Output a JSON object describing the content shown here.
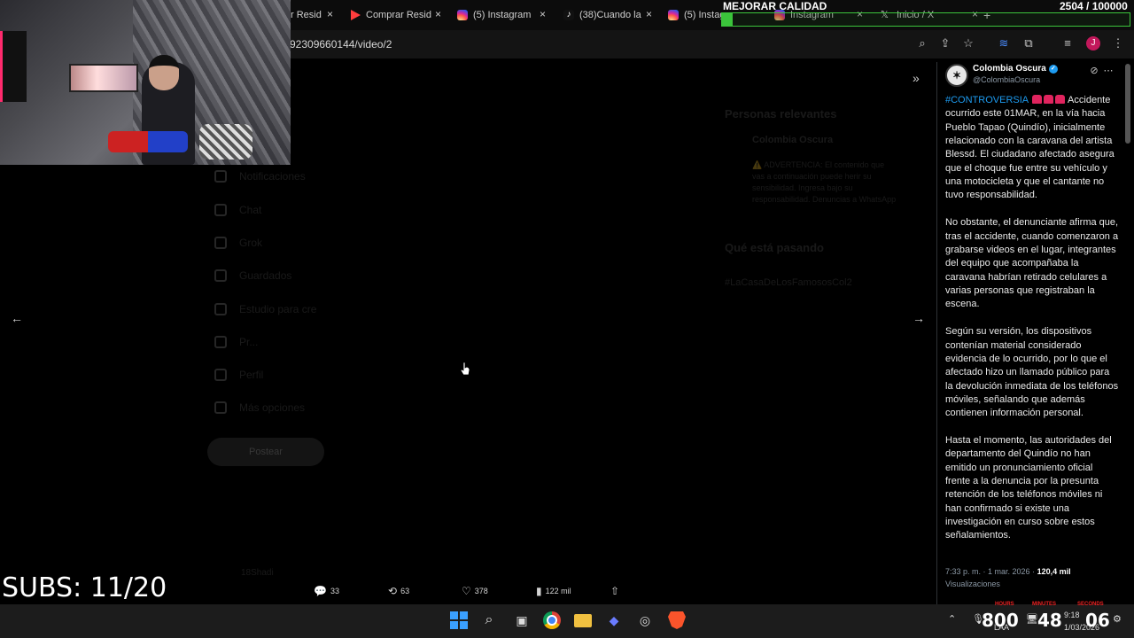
{
  "browser": {
    "tabs": [
      {
        "label": "r Resid",
        "icon": "none"
      },
      {
        "label": "Comprar Resid",
        "icon": "play"
      },
      {
        "label": "(5) Instagram",
        "icon": "instagram"
      },
      {
        "label": "(38)Cuando la",
        "icon": "tiktok"
      },
      {
        "label": "(5) Instagram",
        "icon": "instagram"
      },
      {
        "label": "Instagram",
        "icon": "instagram"
      },
      {
        "label": "Inicio / X",
        "icon": "x"
      }
    ],
    "tab_close": "×",
    "url": "92309660144/video/2",
    "new_tab": "+"
  },
  "overlay": {
    "quality_label": "MEJORAR CALIDAD",
    "goal_text": "2504 / 100000",
    "goal_progress": 0.025,
    "subs_label": "SUBS: 11/20"
  },
  "background_page": {
    "nav_items": [
      "Notificaciones",
      "Chat",
      "Grok",
      "Guardados",
      "Estudio para cre",
      "Pr...",
      "Perfil",
      "Más opciones"
    ],
    "post_button": "Postear",
    "right_heading_1": "Personas relevantes",
    "right_heading_2": "Qué está pasando",
    "relevant_name": "Colombia Oscura",
    "relevant_desc": "⚠️ ADVERTENCIA: El contenido que vas a continuación puede herir su sensibilidad. Ingresa bajo su responsabilidad. Denuncias a WhatsApp",
    "trend": "#LaCasaDeLosFamososCol2",
    "bottom_user": "18Shadi"
  },
  "tweet": {
    "display_name": "Colombia Oscura",
    "handle": "@ColombiaOscura",
    "hashtag": "#CONTROVERSIA",
    "p1_rest": "Accidente ocurrido este 01MAR, en la vía hacia Pueblo Tapao (Quindío), inicialmente relacionado con la caravana del artista Blessd. El ciudadano afectado asegura que el choque fue entre su vehículo y una motocicleta y que el cantante no tuvo responsabilidad.",
    "p2": "No obstante, el denunciante afirma que, tras el accidente, cuando comenzaron a grabarse videos en el lugar, integrantes del equipo que acompañaba la caravana habrían retirado celulares a varias personas que registraban la escena.",
    "p3": "Según su versión, los dispositivos contenían material considerado evidencia de lo ocurrido, por lo que el afectado hizo un llamado público para la devolución inmediata de los teléfonos móviles, señalando que además contienen información personal.",
    "p4": "Hasta el momento, las autoridades del departamento del Quindío no han emitido un pronunciamiento oficial frente a la denuncia por la presunta retención de los teléfonos móviles ni han confirmado si existe una investigación en curso sobre estos señalamientos.",
    "time": "7:33 p. m. · 1 mar. 2026 · ",
    "views_count": "120,4 mil",
    "views_label": "Visualizaciones"
  },
  "actions": {
    "replies": "33",
    "reposts": "63",
    "likes": "378",
    "views": "122 mil"
  },
  "taskbar": {
    "time": "9:18",
    "date": "1/03/2026",
    "lang": "LAA",
    "clock_hours_label": "HOURS",
    "clock_minutes_label": "MINUTES",
    "clock_seconds_label": "SECONDS",
    "clock_hours": "800",
    "clock_minutes": "48",
    "clock_seconds": "06"
  }
}
